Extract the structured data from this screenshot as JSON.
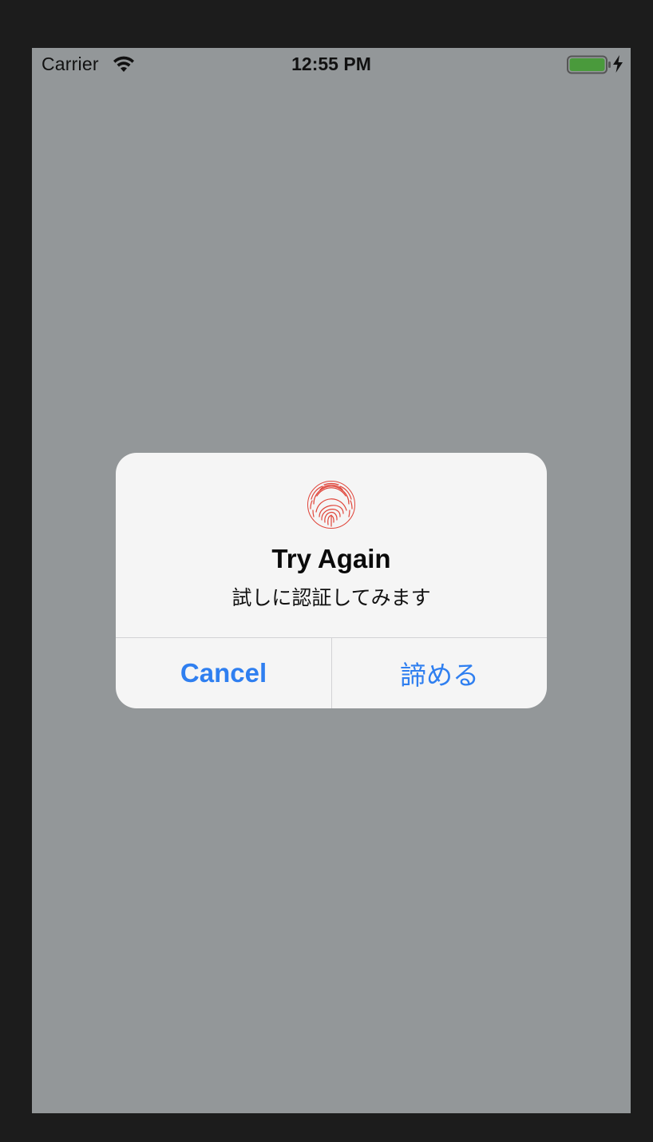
{
  "status_bar": {
    "carrier": "Carrier",
    "time": "12:55 PM",
    "wifi_icon": "wifi-icon",
    "battery_icon": "battery-icon",
    "charging_icon": "charging-bolt-icon",
    "battery_level": 1.0,
    "battery_color": "#4a9a3c"
  },
  "alert": {
    "icon": "fingerprint-icon",
    "icon_color": "#e0453a",
    "title": "Try Again",
    "message": "試しに認証してみます",
    "buttons": [
      {
        "label": "Cancel",
        "style": "bold"
      },
      {
        "label": "諦める",
        "style": "regular"
      }
    ],
    "button_color": "#2f7ff0"
  },
  "colors": {
    "backdrop": "#939799",
    "frame": "#1c1c1c",
    "alert_background": "#f5f5f5"
  }
}
